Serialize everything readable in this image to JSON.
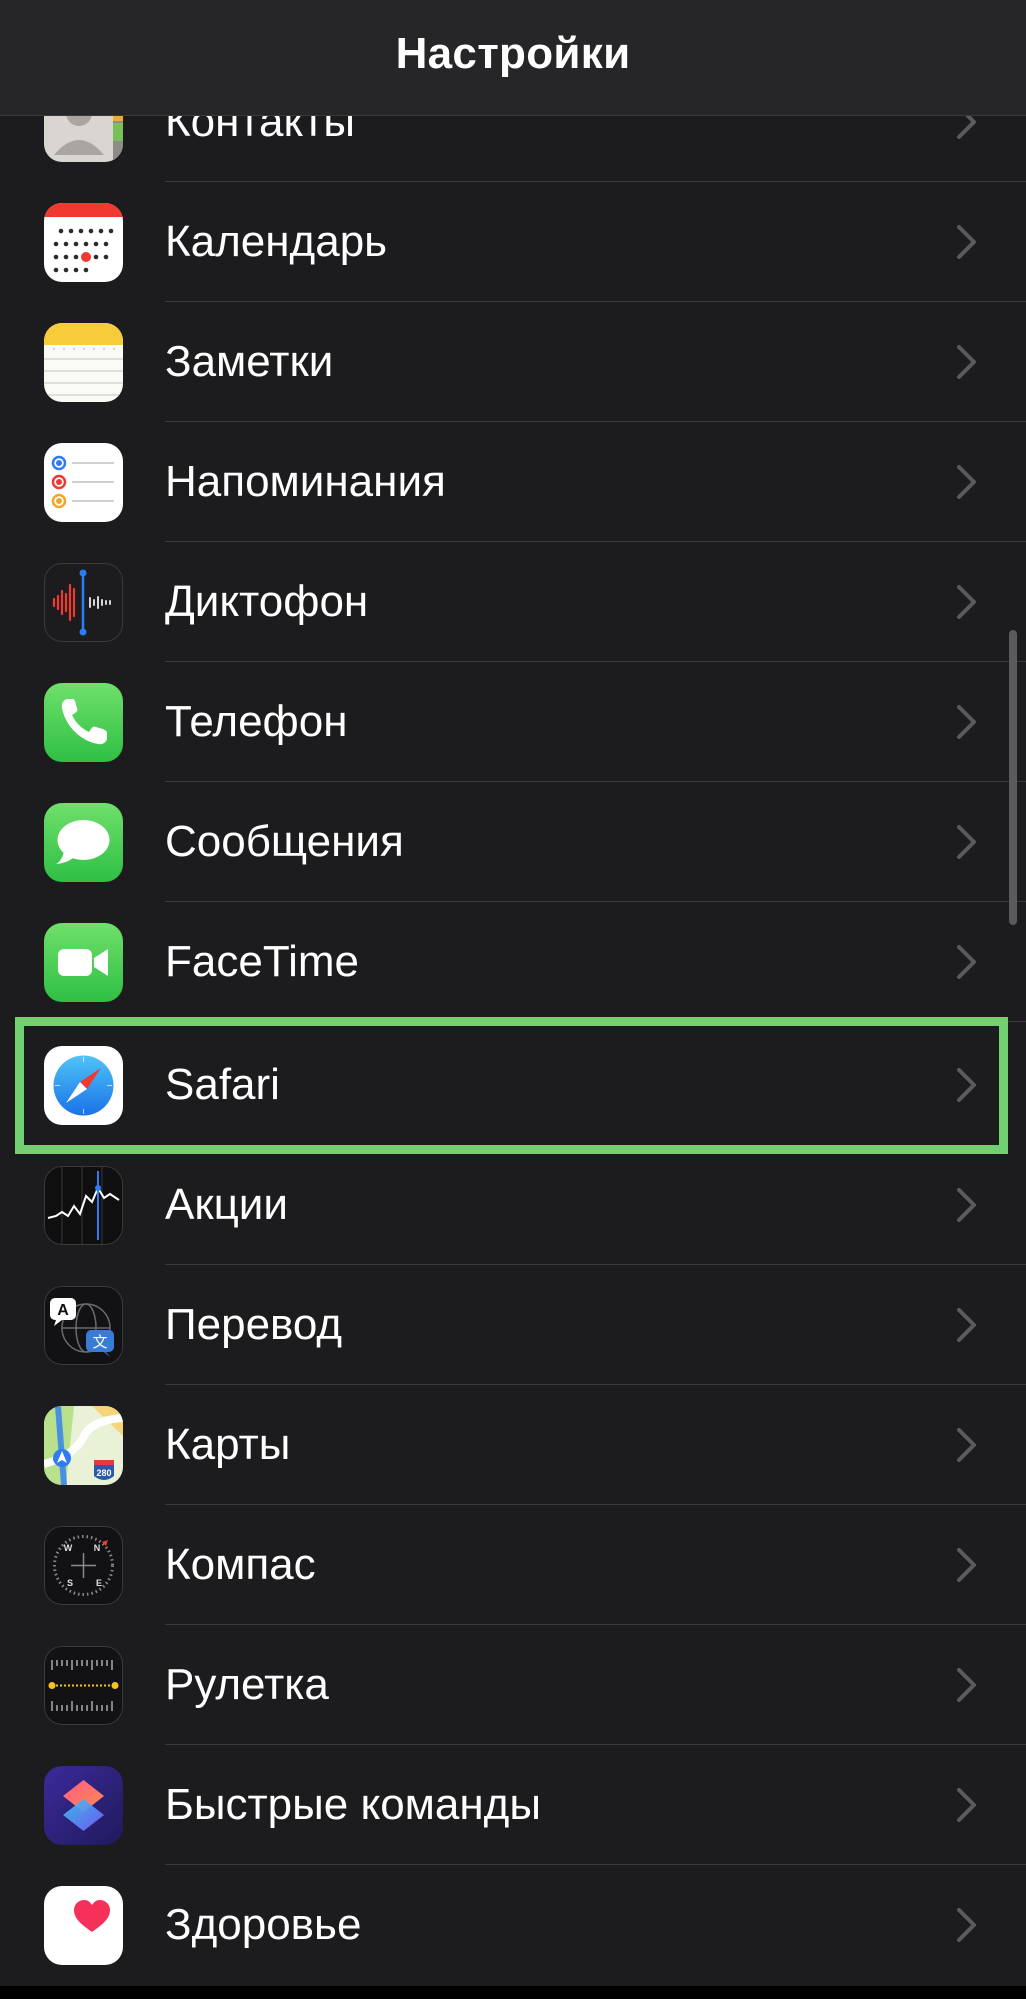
{
  "header": {
    "title": "Настройки"
  },
  "rows": [
    {
      "label": "Контакты",
      "icon": "contacts-icon"
    },
    {
      "label": "Календарь",
      "icon": "calendar-icon"
    },
    {
      "label": "Заметки",
      "icon": "notes-icon"
    },
    {
      "label": "Напоминания",
      "icon": "reminders-icon"
    },
    {
      "label": "Диктофон",
      "icon": "voice-memos-icon"
    },
    {
      "label": "Телефон",
      "icon": "phone-icon"
    },
    {
      "label": "Сообщения",
      "icon": "messages-icon"
    },
    {
      "label": "FaceTime",
      "icon": "facetime-icon"
    },
    {
      "label": "Safari",
      "icon": "safari-icon",
      "highlighted": true
    },
    {
      "label": "Акции",
      "icon": "stocks-icon"
    },
    {
      "label": "Перевод",
      "icon": "translate-icon"
    },
    {
      "label": "Карты",
      "icon": "maps-icon"
    },
    {
      "label": "Компас",
      "icon": "compass-icon"
    },
    {
      "label": "Рулетка",
      "icon": "measure-icon"
    },
    {
      "label": "Быстрые команды",
      "icon": "shortcuts-icon"
    },
    {
      "label": "Здоровье",
      "icon": "health-icon"
    }
  ],
  "icon_glyphs": {
    "translate_a": "A",
    "translate_zh": "文",
    "maps_shield": "280",
    "compass_n": "N",
    "compass_s": "S",
    "compass_w": "W",
    "compass_e": "E"
  },
  "colors": {
    "background": "#1c1c1e",
    "navbar": "#262628",
    "separator": "#3a3a3c",
    "highlight_border": "#72d072",
    "chevron": "#5b5b5f"
  }
}
